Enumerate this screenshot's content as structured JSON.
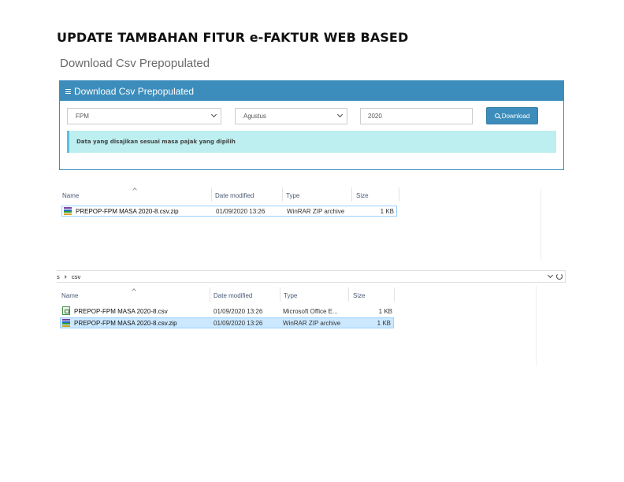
{
  "doc": {
    "title": "UPDATE TAMBAHAN FITUR e-FAKTUR WEB BASED",
    "subtitle": "Download Csv Prepopulated"
  },
  "panel": {
    "header": "Download Csv Prepopulated",
    "jenis": {
      "selected": "FPM"
    },
    "bulan": {
      "selected": "Agustus"
    },
    "tahun": {
      "value": "2020"
    },
    "download_label": "Download",
    "info": "Data yang disajikan sesuai masa pajak yang dipilih",
    "accent_color": "#3c8dbc",
    "info_color": "#bdeef0"
  },
  "explorer1": {
    "columns": [
      "Name",
      "Date modified",
      "Type",
      "Size"
    ],
    "files": [
      {
        "name": "PREPOP-FPM MASA 2020-8.csv.zip",
        "date": "01/09/2020 13:26",
        "type": "WinRAR ZIP archive",
        "size": "1 KB",
        "icon": "winrar-archive-icon"
      }
    ]
  },
  "explorer2": {
    "address": {
      "prefix": "s",
      "folder": "csv"
    },
    "columns": [
      "Name",
      "Date modified",
      "Type",
      "Size"
    ],
    "files": [
      {
        "name": "PREPOP-FPM MASA 2020-8.csv",
        "date": "01/09/2020 13:26",
        "type": "Microsoft Office E...",
        "size": "1 KB",
        "icon": "excel-csv-icon"
      },
      {
        "name": "PREPOP-FPM MASA 2020-8.csv.zip",
        "date": "01/09/2020 13:26",
        "type": "WinRAR ZIP archive",
        "size": "1 KB",
        "icon": "winrar-archive-icon",
        "selected": true
      }
    ]
  }
}
